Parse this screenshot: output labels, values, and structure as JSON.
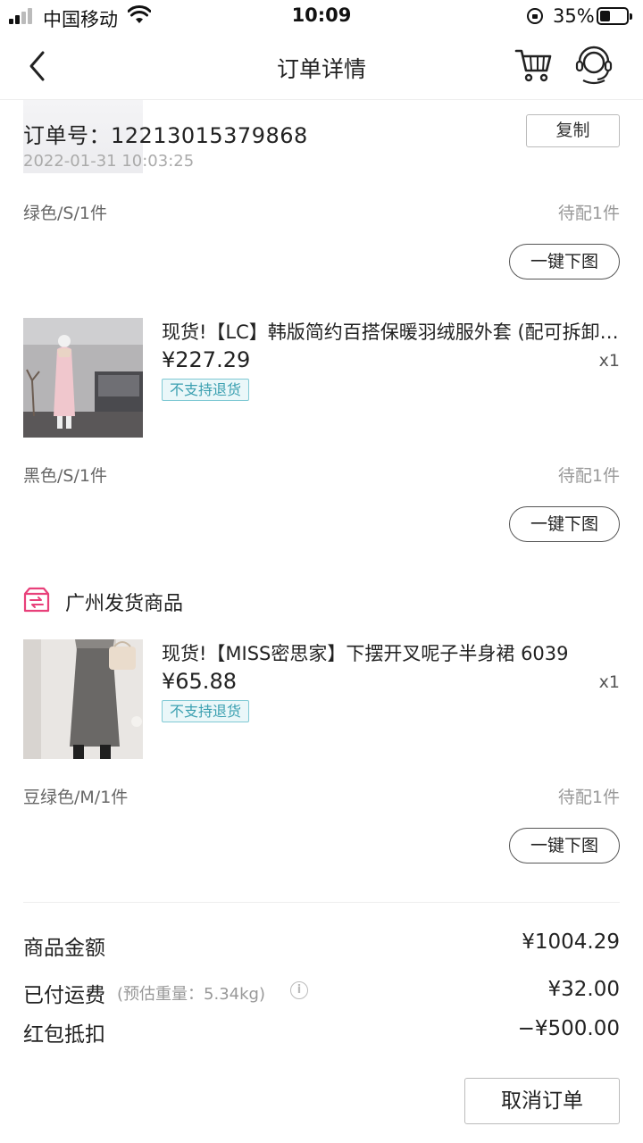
{
  "status_bar": {
    "carrier": "中国移动",
    "time": "10:09",
    "battery_percent": "35%"
  },
  "nav": {
    "title": "订单详情",
    "icons": [
      "back-icon",
      "cart-icon",
      "customer-service-icon"
    ]
  },
  "order": {
    "order_number": "订单号：12213015379868",
    "timestamp": "2022-01-31 10:03:25",
    "copy_label": "复制"
  },
  "items_group_a": [
    {
      "spec": "绿色/S/1件",
      "status": "待配1件",
      "download_label": "一键下图"
    },
    {
      "title": "现货!【LC】韩版简约百搭保暖羽绒服外套 (配可拆卸毛领)",
      "price": "¥227.29",
      "qty": "x1",
      "tag": "不支持退货",
      "spec": "黑色/S/1件",
      "status": "待配1件",
      "download_label": "一键下图"
    }
  ],
  "section_guangzhou": {
    "title": "广州发货商品",
    "icon": "shipping-box-icon",
    "accent": "#e8407a",
    "items": [
      {
        "title": "现货!【MISS密思家】下摆开叉呢子半身裙  6039",
        "price": "¥65.88",
        "qty": "x1",
        "tag": "不支持退货",
        "spec": "豆绿色/M/1件",
        "status": "待配1件",
        "download_label": "一键下图"
      }
    ]
  },
  "summary": {
    "goods_amount_label": "商品金额",
    "goods_amount": "¥1004.29",
    "shipping_label": "已付运费",
    "shipping_note": "(预估重量：5.34kg)",
    "shipping_amount": "¥32.00",
    "redpacket_label": "红包抵扣",
    "redpacket_amount": "−¥500.00"
  },
  "actions": {
    "cancel_order_label": "取消订单"
  },
  "colors": {
    "tag_border": "#7fc9d4",
    "tag_text": "#3a9fb0",
    "tag_bg": "#eaf7f9"
  }
}
